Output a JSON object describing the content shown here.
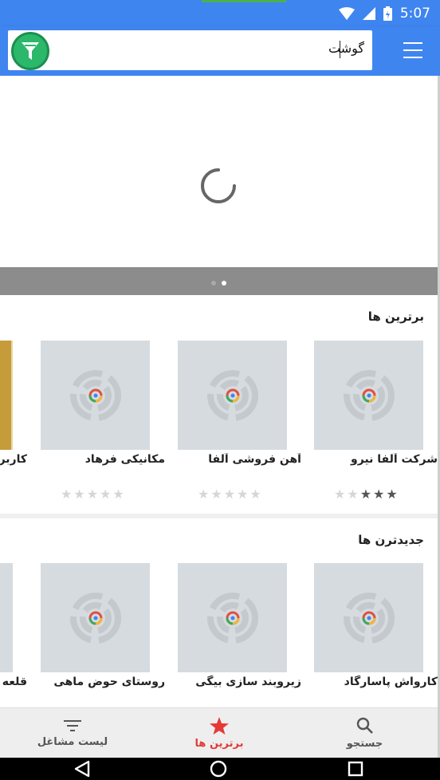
{
  "status_bar": {
    "time": "5:07"
  },
  "search": {
    "value": "گوشت"
  },
  "banner": {
    "page_dots": 2,
    "active_dot": 2
  },
  "colors": {
    "app_bar": "#3f85f0",
    "filter_button": "#2bb86a",
    "active_nav": "#e53935",
    "placeholder": "#d6dbe0"
  },
  "top_section": {
    "title": "برترین ها",
    "cards": [
      {
        "name": "شرکت آلفا نیرو",
        "rating": 3
      },
      {
        "name": "آهن فروشی آلفا",
        "rating": 0
      },
      {
        "name": "مکانیکی فرهاد",
        "rating": 0
      },
      {
        "name": "کاربراتور"
      }
    ]
  },
  "new_section": {
    "title": "جدیدترن ها",
    "cards": [
      {
        "name": "کارواش پاسارگاد"
      },
      {
        "name": "زیروبند سازی بیگی"
      },
      {
        "name": "روستای حوض ماهی"
      },
      {
        "name": "قلعه تاریخی"
      }
    ]
  },
  "bottom_nav": {
    "items": [
      {
        "label": "جستجو",
        "icon": "search-icon"
      },
      {
        "label": "برترین ها",
        "icon": "star-icon",
        "active": true
      },
      {
        "label": "لیست مشاغل",
        "icon": "filter-list-icon"
      }
    ]
  }
}
